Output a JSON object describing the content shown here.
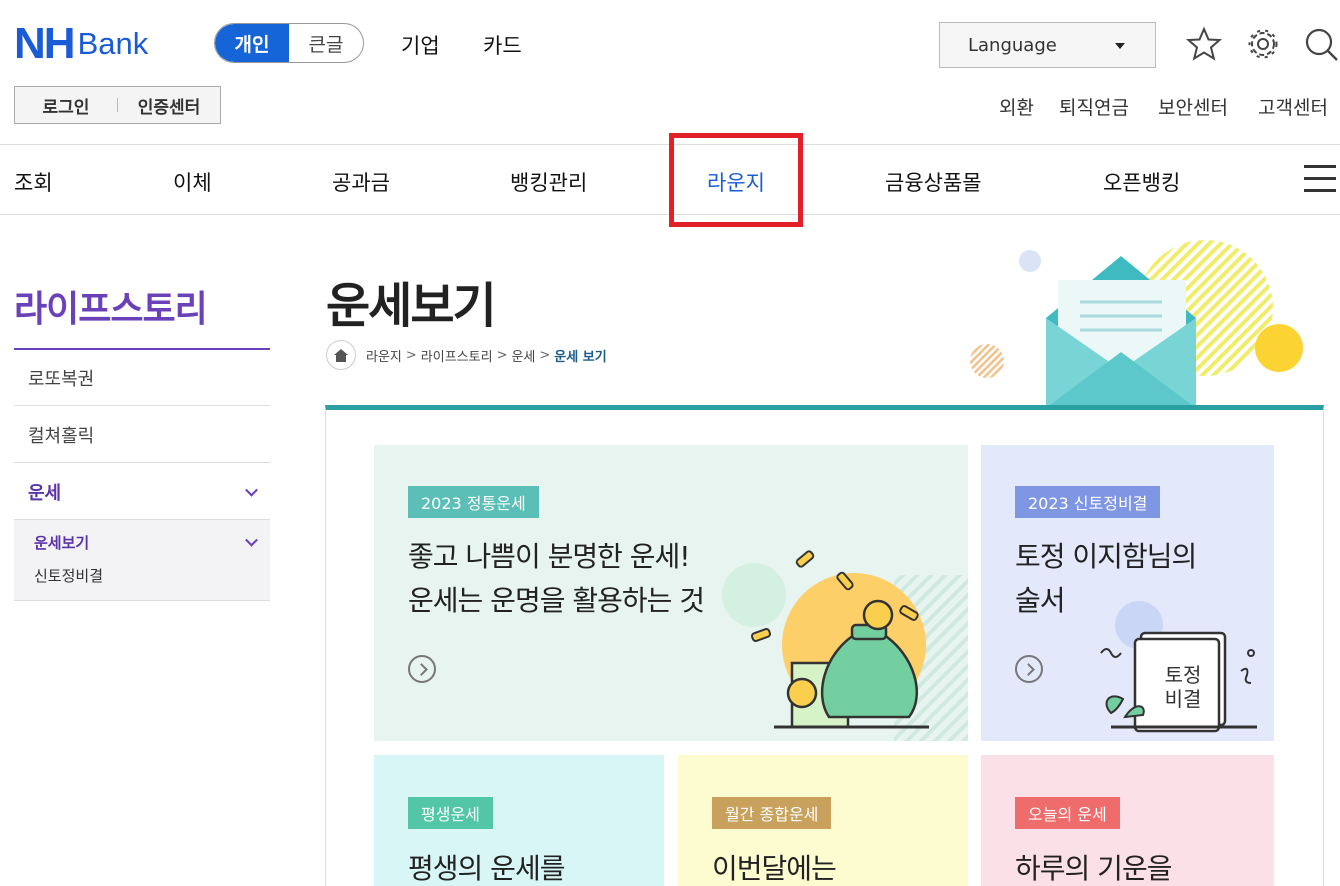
{
  "header": {
    "logo_nh": "NH",
    "logo_bank": "Bank",
    "mode_toggle": {
      "active": "개인",
      "inactive": "큰글"
    },
    "top_nav": [
      "기업",
      "카드"
    ],
    "language": "Language",
    "icons": [
      "star-icon",
      "gear-icon",
      "search-icon"
    ],
    "auth": {
      "login": "로그인",
      "cert": "인증센터"
    },
    "util_links": [
      "외환",
      "퇴직연금",
      "보안센터",
      "고객센터"
    ]
  },
  "gnb": {
    "items": [
      "조회",
      "이체",
      "공과금",
      "뱅킹관리",
      "라운지",
      "금융상품몰",
      "오픈뱅킹"
    ],
    "active": "라운지",
    "highlight_color": "#e1202a"
  },
  "sidebar": {
    "title": "라이프스토리",
    "items": [
      "로또복권",
      "컬쳐홀릭",
      "운세"
    ],
    "sub_items": [
      "운세보기",
      "신토정비결"
    ]
  },
  "main": {
    "title": "운세보기",
    "breadcrumb": [
      "라운지",
      "라이프스토리",
      "운세",
      "운세 보기"
    ],
    "cards": [
      {
        "badge": "2023 정통운세",
        "line1": "좋고 나쁨이 분명한 운세!",
        "line2": "운세는 운명을 활용하는 것",
        "bg": "#e8f4ef",
        "badge_color": "#5bbfb7"
      },
      {
        "badge": "2023 신토정비결",
        "line1": "토정 이지함님의",
        "line2": "술서",
        "bg": "#e3e8fb",
        "badge_color": "#7f96e3",
        "book_text1": "토정",
        "book_text2": "비결"
      },
      {
        "badge": "평생운세",
        "line1": "평생의 운세를",
        "bg": "#d9f6f6",
        "badge_color": "#52c6a6"
      },
      {
        "badge": "월간 종합운세",
        "line1": "이번달에는",
        "bg": "#fdfbd0",
        "badge_color": "#c8a25c"
      },
      {
        "badge": "오늘의 운세",
        "line1": "하루의 기운을",
        "bg": "#fbe0e7",
        "badge_color": "#ef6c6c"
      }
    ]
  }
}
